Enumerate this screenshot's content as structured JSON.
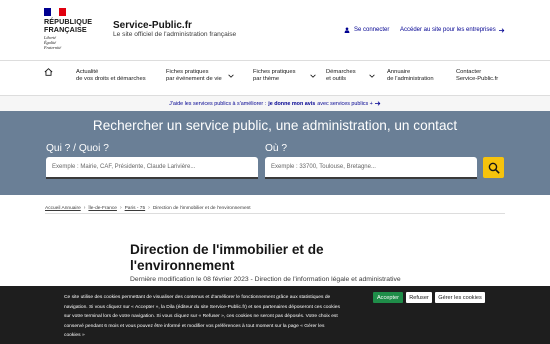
{
  "brand": {
    "republic_line1": "RÉPUBLIQUE",
    "republic_line2": "FRANÇAISE",
    "motto": [
      "Liberté",
      "Égalité",
      "Fraternité"
    ],
    "flag_colors": [
      "#000091",
      "#ffffff",
      "#e1000f"
    ]
  },
  "site": {
    "title": "Service-Public.fr",
    "subtitle": "Le site officiel de l'administration française"
  },
  "header_links": {
    "connect": "Se connecter",
    "pro": "Accéder au site pour les entreprises",
    "accent": "#000091"
  },
  "nav": {
    "items": [
      {
        "line1": "Actualité",
        "line2": "de vos droits et démarches"
      },
      {
        "line1": "Fiches pratiques",
        "line2": "par événement de vie"
      },
      {
        "line1": "Fiches pratiques",
        "line2": "par thème"
      },
      {
        "line1": "Démarches",
        "line2": "et outils"
      },
      {
        "line1": "Annuaire",
        "line2": "de l'administration"
      },
      {
        "line1": "Contacter",
        "line2": "Service-Public.fr"
      }
    ]
  },
  "notice": {
    "pre": "J'aide les services publics à s'améliorer :",
    "bold": "je donne mon avis",
    "post": "avec services publics +"
  },
  "search": {
    "title": "Rechercher un service public, une administration, un contact",
    "what_label": "Qui ? / Quoi ?",
    "what_placeholder": "Exemple : Mairie, CAF, Présidente, Claude Larivière...",
    "where_label": "Où ?",
    "where_placeholder": "Exemple : 33700, Toulouse, Bretagne...",
    "band_color": "#6a7f96",
    "button_color": "#f6c30d"
  },
  "breadcrumb": {
    "items": [
      "Accueil Annuaire",
      "Île-de-France",
      "Paris - 75",
      "Direction de l'immobilier et de l'environnement"
    ]
  },
  "page": {
    "title": "Direction de l'immobilier et de l'environnement",
    "updated": "Dernière modification le 08 février 2023 - Direction de l'information légale et administrative"
  },
  "cookie": {
    "lines": [
      "Ce site utilise des cookies permettant de visualiser des contenus et d'améliorer le fonctionnement grâce aux statistiques de",
      "navigation. Si vous cliquez sur « Accepter », la Dila (éditeur du site Service-Public.fr) et ses partenaires déposeront ces cookies",
      "sur votre terminal lors de votre navigation. Si vous cliquez sur « Refuser », ces cookies ne seront pas déposés. Votre choix est",
      "conservé pendant 6 mois et vous pouvez être informé et modifier vos préférences à tout moment sur la page « Gérer les",
      "cookies »"
    ],
    "accept": "Accepter",
    "refuse": "Refuser",
    "manage": "Gérer les cookies"
  }
}
